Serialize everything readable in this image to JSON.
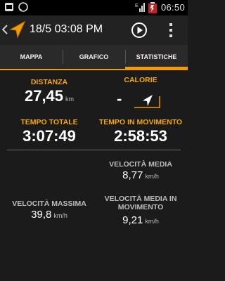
{
  "status_bar": {
    "time": "06:50",
    "left_icons": [
      "notification-icon",
      "whatsapp-icon"
    ],
    "right_icons": [
      "signal-icon",
      "battery-icon"
    ]
  },
  "action_bar": {
    "title": "18/5 03:08 PM",
    "icons": [
      "back-icon",
      "arrow-icon",
      "play-icon",
      "overflow-menu-icon"
    ]
  },
  "tabs": [
    {
      "label": "MAPPA",
      "active": false
    },
    {
      "label": "GRAFICO",
      "active": false
    },
    {
      "label": "STATISTICHE",
      "active": true
    }
  ],
  "stats": {
    "distance": {
      "label": "DISTANZA",
      "value": "27,45",
      "unit": "km"
    },
    "calories": {
      "label": "CALORIE",
      "value": "-"
    },
    "total_time": {
      "label": "TEMPO TOTALE",
      "value": "3:07:49"
    },
    "moving_time": {
      "label": "TEMPO IN MOVIMENTO",
      "value": "2:58:53"
    },
    "avg_speed": {
      "label": "VELOCITÀ MEDIA",
      "value": "8,77",
      "unit": "km/h"
    },
    "max_speed": {
      "label": "VELOCITÀ MASSIMA",
      "value": "39,8",
      "unit": "km/h"
    },
    "avg_moving_speed": {
      "label_line1": "VELOCITÀ MEDIA IN",
      "label_line2": "MOVIMENTO",
      "value": "9,21",
      "unit": "km/h"
    }
  },
  "colors": {
    "accent": "#f39c00",
    "background": "#1b1b1b",
    "label_orange": "#f5a800"
  }
}
